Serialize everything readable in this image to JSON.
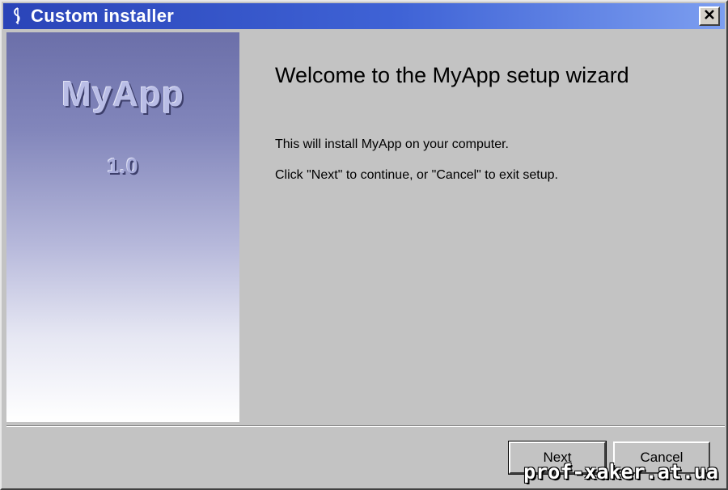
{
  "window": {
    "title": "Custom installer",
    "close_glyph": "✕",
    "icon": "installer-icon"
  },
  "side_panel": {
    "app_name": "MyApp",
    "version": "1.0"
  },
  "content": {
    "heading": "Welcome to the MyApp setup wizard",
    "line1": "This will install MyApp on your computer.",
    "line2": "Click \"Next\" to continue, or \"Cancel\" to exit setup."
  },
  "buttons": {
    "next_label": "Next",
    "cancel_label": "Cancel"
  },
  "watermark": "prof-xaker.at.ua",
  "colors": {
    "titlebar": "#2a44b8",
    "face": "#c3c3c3",
    "side_top": "#6b6fa9"
  }
}
